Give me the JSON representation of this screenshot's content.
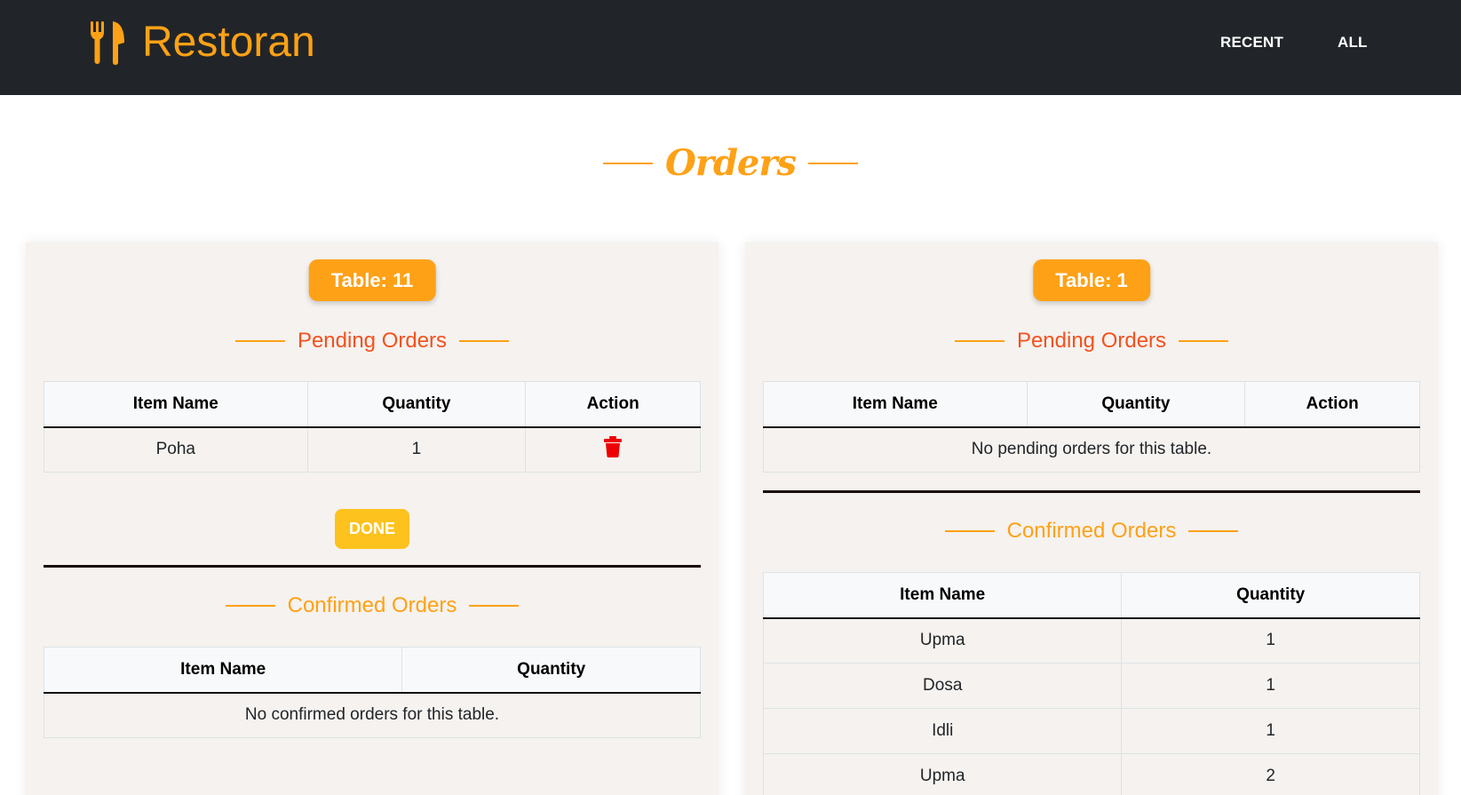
{
  "brand": {
    "name": "Restoran",
    "icon": "utensils-icon"
  },
  "nav": {
    "recent": "RECENT",
    "all": "ALL"
  },
  "page": {
    "title": "Orders"
  },
  "colors": {
    "primary": "#fea116",
    "pending_title": "#f4511e",
    "done_button": "#fdc21d",
    "delete_icon": "#ee0000",
    "navbar": "#212529"
  },
  "cards": [
    {
      "table_label": "Table: 11",
      "pending": {
        "title": "Pending Orders",
        "headers": [
          "Item Name",
          "Quantity",
          "Action"
        ],
        "rows": [
          {
            "item": "Poha",
            "qty": "1",
            "action_icon": "trash-icon"
          }
        ],
        "done_label": "DONE"
      },
      "confirmed": {
        "title": "Confirmed Orders",
        "headers": [
          "Item Name",
          "Quantity"
        ],
        "empty_text": "No confirmed orders for this table."
      }
    },
    {
      "table_label": "Table: 1",
      "pending": {
        "title": "Pending Orders",
        "headers": [
          "Item Name",
          "Quantity",
          "Action"
        ],
        "empty_text": "No pending orders for this table."
      },
      "confirmed": {
        "title": "Confirmed Orders",
        "headers": [
          "Item Name",
          "Quantity"
        ],
        "rows": [
          {
            "item": "Upma",
            "qty": "1"
          },
          {
            "item": "Dosa",
            "qty": "1"
          },
          {
            "item": "Idli",
            "qty": "1"
          },
          {
            "item": "Upma",
            "qty": "2"
          }
        ]
      }
    }
  ]
}
